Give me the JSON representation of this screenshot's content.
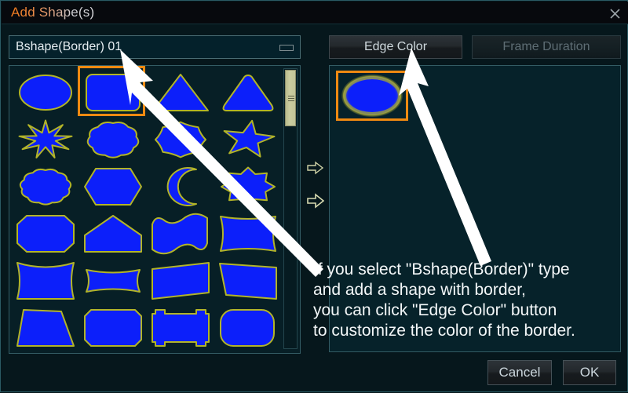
{
  "window": {
    "title": "Add Shape(s)",
    "close_icon": "close-icon"
  },
  "left_panel": {
    "combo": {
      "value": "Bshape(Border) 01",
      "glyph": "restore-rectangle-icon"
    },
    "shapes": [
      {
        "name": "ellipse",
        "selected": false
      },
      {
        "name": "rounded-rectangle",
        "selected": true
      },
      {
        "name": "triangle",
        "selected": false
      },
      {
        "name": "rounded-triangle",
        "selected": false
      },
      {
        "name": "nine-point-star",
        "selected": false
      },
      {
        "name": "cloud",
        "selected": false
      },
      {
        "name": "seal-burst",
        "selected": false
      },
      {
        "name": "five-point-star",
        "selected": false
      },
      {
        "name": "scalloped-cloud",
        "selected": false
      },
      {
        "name": "hexagon",
        "selected": false
      },
      {
        "name": "crescent-moon",
        "selected": false
      },
      {
        "name": "eight-point-star",
        "selected": false
      },
      {
        "name": "octagon",
        "selected": false
      },
      {
        "name": "pentagon-home",
        "selected": false
      },
      {
        "name": "wave",
        "selected": false
      },
      {
        "name": "pillow-cushion",
        "selected": false
      },
      {
        "name": "bowtie-vertical",
        "selected": false
      },
      {
        "name": "bowtie-horizontal",
        "selected": false
      },
      {
        "name": "trapezoid-left",
        "selected": false
      },
      {
        "name": "trapezoid-right",
        "selected": false
      },
      {
        "name": "trapezoid-down",
        "selected": false
      },
      {
        "name": "snip-corner-rectangle",
        "selected": false
      },
      {
        "name": "tabbed-rectangle",
        "selected": false
      },
      {
        "name": "stadium-rectangle",
        "selected": false
      }
    ],
    "scrollbar": {
      "position": "top"
    }
  },
  "transfer": {
    "arrow_1": "arrow-right-outline-icon",
    "arrow_2": "arrow-right-outline-icon"
  },
  "right_panel": {
    "tabs": [
      {
        "label": "Edge Color",
        "enabled": true
      },
      {
        "label": "Frame Duration",
        "enabled": false
      }
    ],
    "preview": [
      {
        "name": "ellipse-with-border",
        "selected": true
      }
    ]
  },
  "annotation": {
    "lines": [
      "If you select \"Bshape(Border)\" type",
      "and add a shape with border,",
      "you can click \"Edge Color\" button",
      "to customize the color of the border."
    ]
  },
  "footer": {
    "cancel_label": "Cancel",
    "ok_label": "OK"
  },
  "colors": {
    "shape_fill": "#0c1ffa",
    "shape_stroke": "#b2b428",
    "selection": "#ef8a11",
    "panel_bg": "#071f26",
    "window_bg": "#06171c",
    "title_accent": "#f07818",
    "scrollbar_thumb": "#c2c497",
    "annotation_text": "#f3f7f8"
  }
}
